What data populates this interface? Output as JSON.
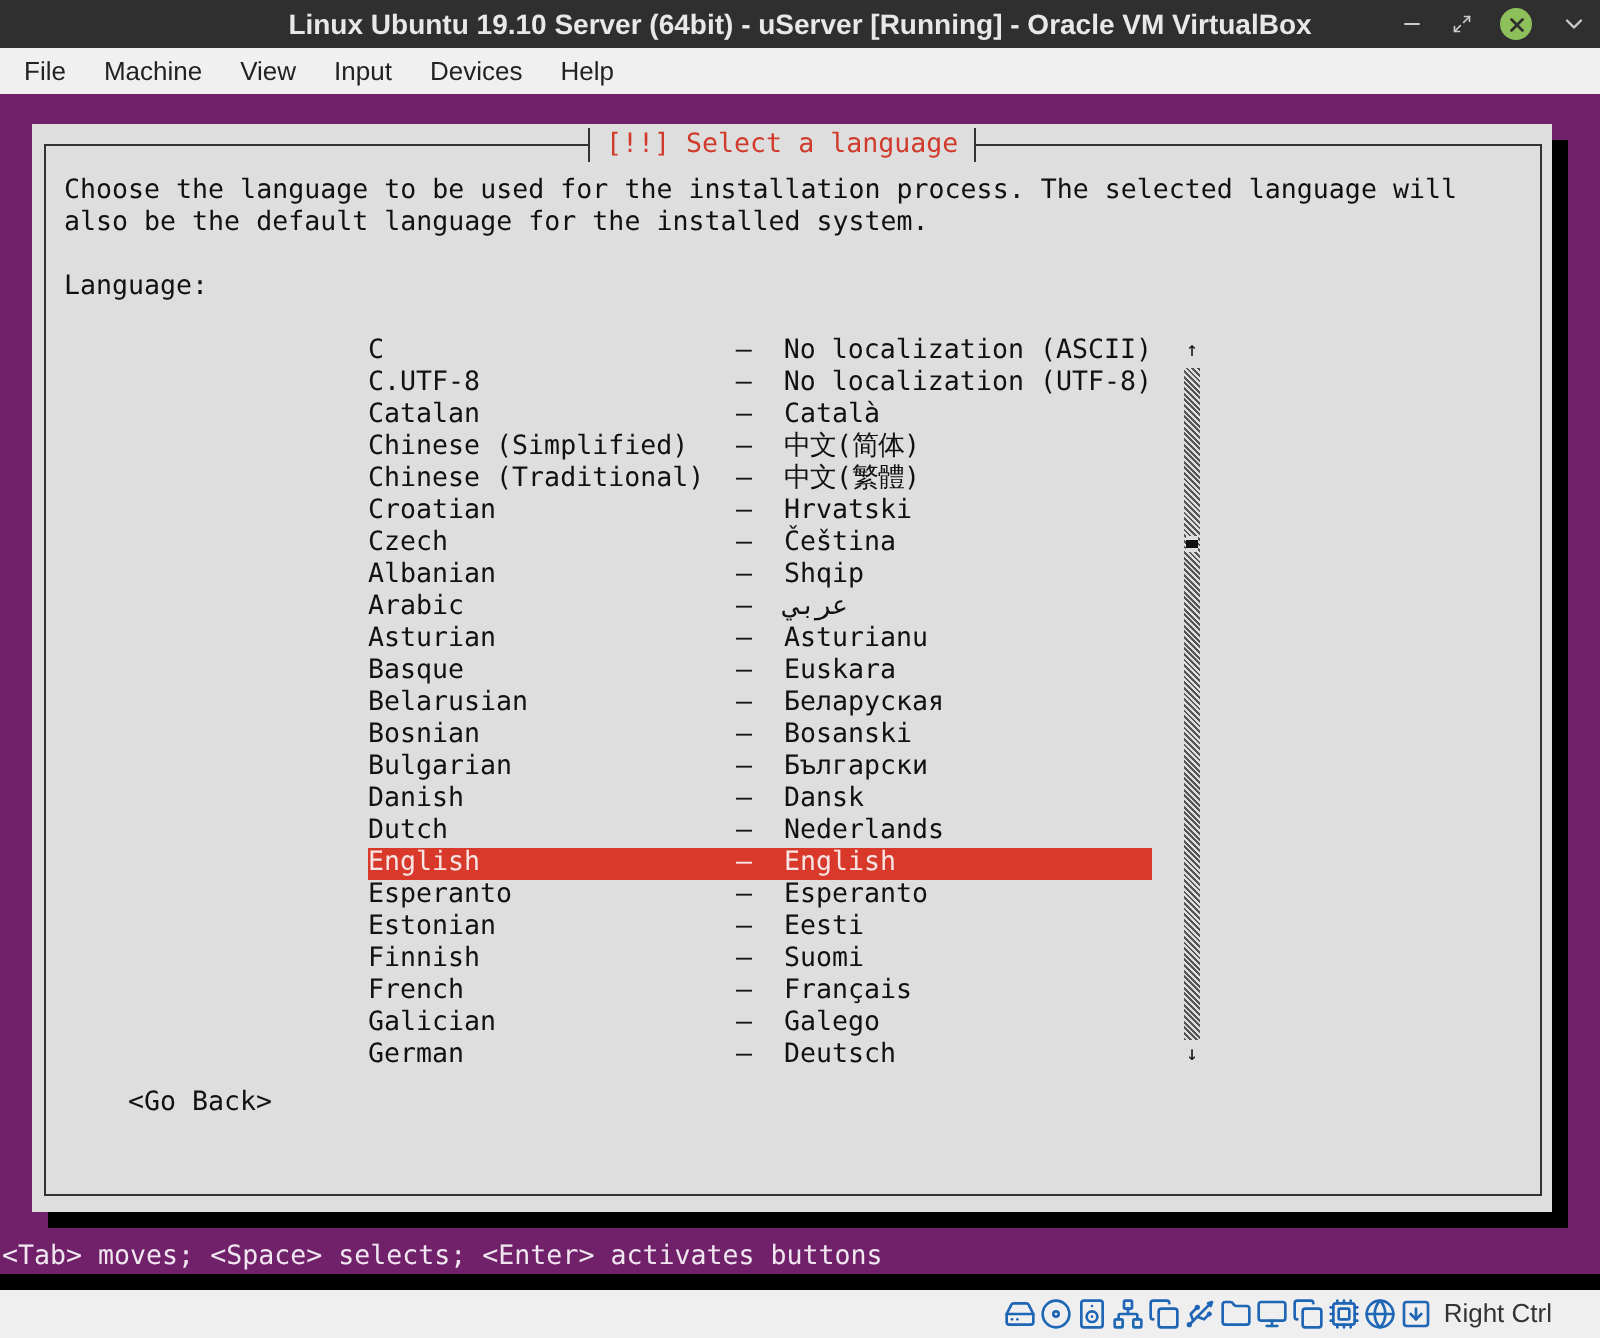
{
  "window": {
    "title": "Linux Ubuntu 19.10 Server (64bit) - uServer [Running] - Oracle VM VirtualBox"
  },
  "menu": [
    "File",
    "Machine",
    "View",
    "Input",
    "Devices",
    "Help"
  ],
  "dialog": {
    "title": "[!!] Select a language",
    "instructions": "Choose the language to be used for the installation process. The selected language will also be the default language for the installed system.",
    "list_label": "Language:",
    "languages": [
      {
        "name": "C",
        "separator": "–",
        "native": "No localization (ASCII)",
        "selected": false
      },
      {
        "name": "C.UTF-8",
        "separator": "–",
        "native": "No localization (UTF-8)",
        "selected": false
      },
      {
        "name": "Catalan",
        "separator": "–",
        "native": "Català",
        "selected": false
      },
      {
        "name": "Chinese (Simplified)",
        "separator": "–",
        "native": "中文(简体)",
        "selected": false
      },
      {
        "name": "Chinese (Traditional)",
        "separator": "–",
        "native": "中文(繁體)",
        "selected": false
      },
      {
        "name": "Croatian",
        "separator": "–",
        "native": "Hrvatski",
        "selected": false
      },
      {
        "name": "Czech",
        "separator": "–",
        "native": "Čeština",
        "selected": false
      },
      {
        "name": "Albanian",
        "separator": "–",
        "native": "Shqip",
        "selected": false
      },
      {
        "name": "Arabic",
        "separator": "–",
        "native": "عربي",
        "selected": false
      },
      {
        "name": "Asturian",
        "separator": "–",
        "native": "Asturianu",
        "selected": false
      },
      {
        "name": "Basque",
        "separator": "–",
        "native": "Euskara",
        "selected": false
      },
      {
        "name": "Belarusian",
        "separator": "–",
        "native": "Беларуская",
        "selected": false
      },
      {
        "name": "Bosnian",
        "separator": "–",
        "native": "Bosanski",
        "selected": false
      },
      {
        "name": "Bulgarian",
        "separator": "–",
        "native": "Български",
        "selected": false
      },
      {
        "name": "Danish",
        "separator": "–",
        "native": "Dansk",
        "selected": false
      },
      {
        "name": "Dutch",
        "separator": "–",
        "native": "Nederlands",
        "selected": false
      },
      {
        "name": "English",
        "separator": "–",
        "native": "English",
        "selected": true
      },
      {
        "name": "Esperanto",
        "separator": "–",
        "native": "Esperanto",
        "selected": false
      },
      {
        "name": "Estonian",
        "separator": "–",
        "native": "Eesti",
        "selected": false
      },
      {
        "name": "Finnish",
        "separator": "–",
        "native": "Suomi",
        "selected": false
      },
      {
        "name": "French",
        "separator": "–",
        "native": "Français",
        "selected": false
      },
      {
        "name": "Galician",
        "separator": "–",
        "native": "Galego",
        "selected": false
      },
      {
        "name": "German",
        "separator": "–",
        "native": "Deutsch",
        "selected": false
      }
    ],
    "scroll_up": "↑",
    "scroll_down": "↓",
    "go_back": "<Go Back>"
  },
  "help_line": "<Tab> moves; <Space> selects; <Enter> activates buttons",
  "status_bar": {
    "host_key": "Right Ctrl"
  }
}
